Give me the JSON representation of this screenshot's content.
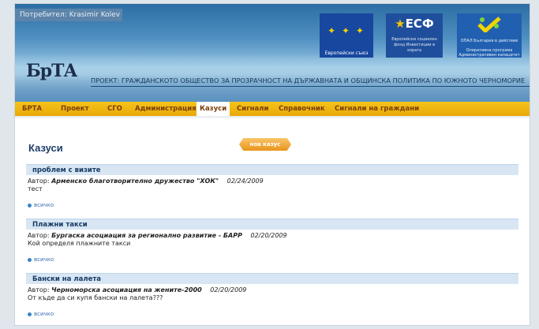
{
  "header": {
    "user": "Потребител: Krasimir Kolev",
    "eu_caption": "Европейски съюз",
    "esf_mark": "ЕСФ",
    "esf_text": "Европейски социален фонд Инвестиции в хората",
    "op_text1": "ОПАЛ България в действие",
    "op_text2": "Оперативна програма Административен капацитет",
    "brand": "БрТА",
    "project": "ПРОЕКТ: ГРАЖДАНСКОТО ОБЩЕСТВО ЗА ПРОЗРАЧНОСТ НА ДЪРЖАВНАТА И ОБЩИНСКА ПОЛИТИКА ПО ЮЖНОТО ЧЕРНОМОРИЕ"
  },
  "nav": {
    "items": [
      "БРТА",
      "Проект",
      "СГО",
      "Администрация",
      "Казуси",
      "Сигнали",
      "Справочник",
      "Сигнали на граждани"
    ],
    "active": "Казуси"
  },
  "page": {
    "title": "Казуси",
    "new_button": "нов казус",
    "author_label": "Автор:",
    "all_link": "всичко"
  },
  "cases": [
    {
      "title": "проблем с визите",
      "author": "Арменско благотворително дружество \"ХОК\"",
      "date": "02/24/2009",
      "text": "тест"
    },
    {
      "title": "Плажни такси",
      "author": "Бургаска асоциация за регионално развитие - БАРР",
      "date": "02/20/2009",
      "text": "Кой определя плажните такси"
    },
    {
      "title": "Бански на лалета",
      "author": "Черноморска асоциация на жените-2000",
      "date": "02/20/2009",
      "text": "От къде да си купя бански на лалета???"
    }
  ],
  "colors": {
    "nav": "#f4c31a",
    "accent": "#1d3e6a",
    "button": "#e9941c"
  }
}
